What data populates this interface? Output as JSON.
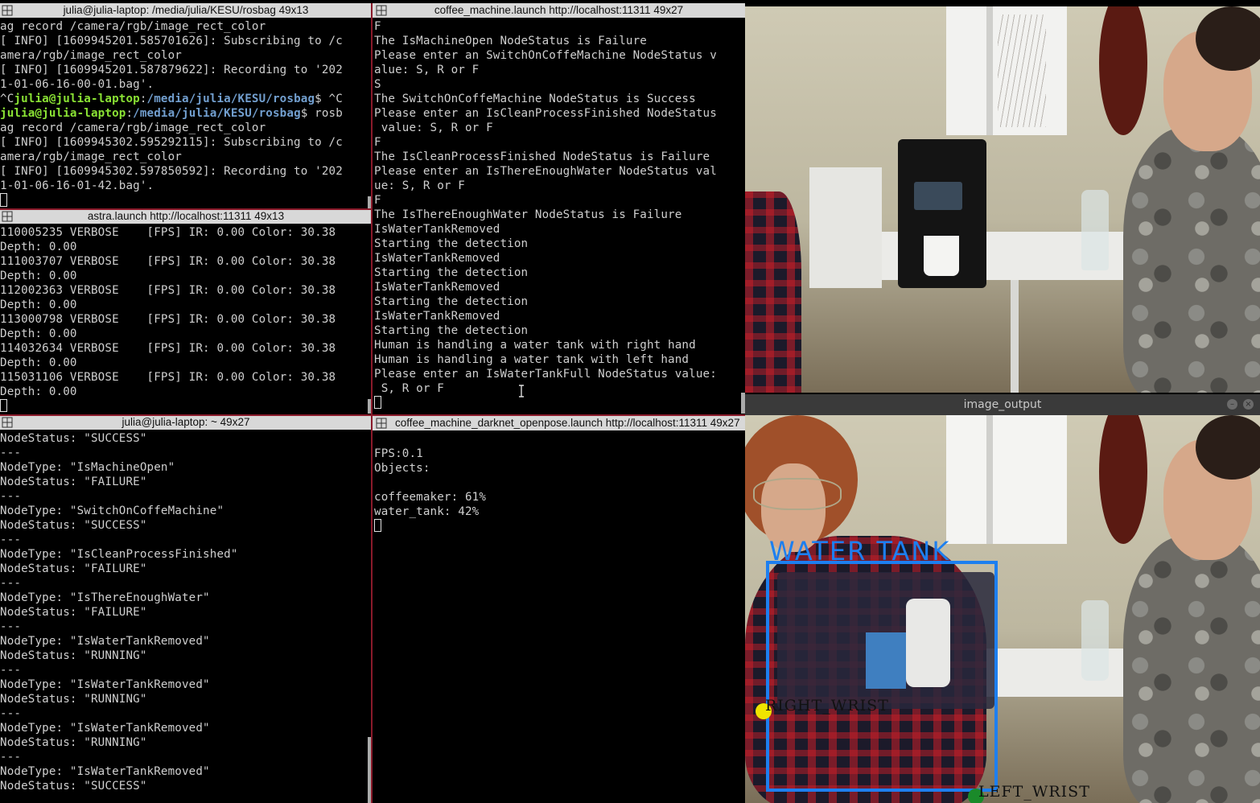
{
  "terminals": {
    "rosbag": {
      "title": "julia@julia-laptop: /media/julia/KESU/rosbag 49x13",
      "lines": [
        "ag record /camera/rgb/image_rect_color",
        "[ INFO] [1609945201.585701626]: Subscribing to /c",
        "amera/rgb/image_rect_color",
        "[ INFO] [1609945201.587879622]: Recording to '202",
        "1-01-06-16-00-01.bag'.",
        "",
        "",
        "ag record /camera/rgb/image_rect_color",
        "[ INFO] [1609945302.595292115]: Subscribing to /c",
        "amera/rgb/image_rect_color",
        "[ INFO] [1609945302.597850592]: Recording to '202",
        "1-01-06-16-01-42.bag'."
      ],
      "prompt1": {
        "prefix": "^C",
        "user": "julia@julia-laptop",
        "sep": ":",
        "path": "/media/julia/KESU/rosbag",
        "suffix": "$ ^C"
      },
      "prompt2": {
        "prefix": "",
        "user": "julia@julia-laptop",
        "sep": ":",
        "path": "/media/julia/KESU/rosbag",
        "suffix": "$ rosb"
      }
    },
    "astra": {
      "title": "astra.launch http://localhost:11311 49x13",
      "lines": [
        "110005235 VERBOSE    [FPS] IR: 0.00 Color: 30.38",
        "Depth: 0.00",
        "111003707 VERBOSE    [FPS] IR: 0.00 Color: 30.38",
        "Depth: 0.00",
        "112002363 VERBOSE    [FPS] IR: 0.00 Color: 30.38",
        "Depth: 0.00",
        "113000798 VERBOSE    [FPS] IR: 0.00 Color: 30.38",
        "Depth: 0.00",
        "114032634 VERBOSE    [FPS] IR: 0.00 Color: 30.38",
        "Depth: 0.00",
        "115031106 VERBOSE    [FPS] IR: 0.00 Color: 30.38",
        "Depth: 0.00"
      ]
    },
    "home": {
      "title": "julia@julia-laptop: ~ 49x27",
      "lines": [
        "NodeStatus: \"SUCCESS\"",
        "---",
        "NodeType: \"IsMachineOpen\"",
        "NodeStatus: \"FAILURE\"",
        "---",
        "NodeType: \"SwitchOnCoffeMachine\"",
        "NodeStatus: \"SUCCESS\"",
        "---",
        "NodeType: \"IsCleanProcessFinished\"",
        "NodeStatus: \"FAILURE\"",
        "---",
        "NodeType: \"IsThereEnoughWater\"",
        "NodeStatus: \"FAILURE\"",
        "---",
        "NodeType: \"IsWaterTankRemoved\"",
        "NodeStatus: \"RUNNING\"",
        "---",
        "NodeType: \"IsWaterTankRemoved\"",
        "NodeStatus: \"RUNNING\"",
        "---",
        "NodeType: \"IsWaterTankRemoved\"",
        "NodeStatus: \"RUNNING\"",
        "---",
        "NodeType: \"IsWaterTankRemoved\"",
        "NodeStatus: \"SUCCESS\""
      ]
    },
    "coffee": {
      "title": "coffee_machine.launch http://localhost:11311 49x27",
      "lines": [
        "F",
        "The IsMachineOpen NodeStatus is Failure",
        "Please enter an SwitchOnCoffeMachine NodeStatus v",
        "alue: S, R or F",
        "S",
        "The SwitchOnCoffeMachine NodeStatus is Success",
        "Please enter an IsCleanProcessFinished NodeStatus",
        " value: S, R or F",
        "F",
        "The IsCleanProcessFinished NodeStatus is Failure",
        "Please enter an IsThereEnoughWater NodeStatus val",
        "ue: S, R or F",
        "F",
        "The IsThereEnoughWater NodeStatus is Failure",
        "IsWaterTankRemoved",
        "Starting the detection",
        "IsWaterTankRemoved",
        "Starting the detection",
        "IsWaterTankRemoved",
        "Starting the detection",
        "IsWaterTankRemoved",
        "Starting the detection",
        "Human is handling a water tank with right hand",
        "Human is handling a water tank with left hand",
        "Please enter an IsWaterTankFull NodeStatus value:",
        " S, R or F"
      ]
    },
    "darknet": {
      "title": "coffee_machine_darknet_openpose.launch http://localhost:11311 49x27",
      "lines": [
        "",
        "FPS:0.1",
        "Objects:",
        "",
        "coffeemaker: 61%",
        "water_tank: 42%"
      ]
    }
  },
  "image_output": {
    "title": "image_output",
    "bbox_label": "WATER TANK",
    "bbox_color": "#1d7ff0",
    "keypoints": [
      {
        "label": "RIGHT_WRIST",
        "color": "#f0e400"
      },
      {
        "label": "LEFT_WRIST",
        "color": "#1a8a2a"
      }
    ]
  },
  "icons": {
    "terminal_grid": "grid-icon",
    "minimize": "minimize-icon",
    "close": "close-icon"
  }
}
